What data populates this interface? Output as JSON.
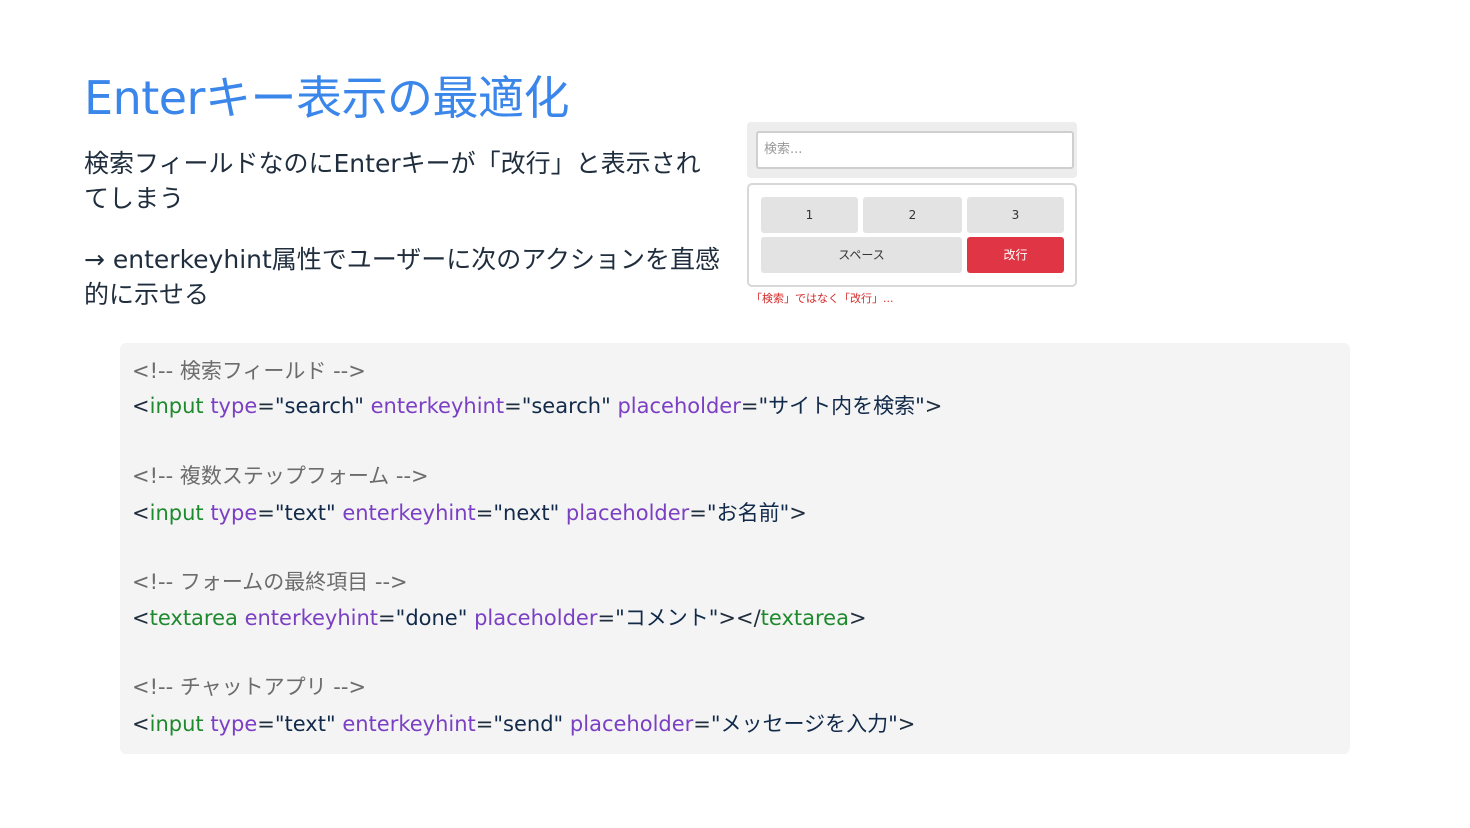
{
  "title": "Enterキー表示の最適化",
  "description": {
    "line1": "検索フィールドなのにEnterキーが「改行」と表示されてしまう",
    "line2": "→ enterkeyhint属性でユーザーに次のアクションを直感的に示せる"
  },
  "demo": {
    "search_placeholder": "検索...",
    "keys": [
      "1",
      "2",
      "3"
    ],
    "space_label": "スペース",
    "enter_label": "改行",
    "caption": "「検索」ではなく「改行」..."
  },
  "code": {
    "comment1": "<!-- 検索フィールド -->",
    "comment2": "<!-- 複数ステップフォーム -->",
    "comment3": "<!-- フォームの最終項目 -->",
    "comment4": "<!-- チャットアプリ -->",
    "tag_input": "input",
    "tag_textarea": "textarea",
    "attr_type": "type",
    "attr_enterkeyhint": "enterkeyhint",
    "attr_placeholder": "placeholder",
    "val_search": "\"search\"",
    "val_text": "\"text\"",
    "val_next": "\"next\"",
    "val_done": "\"done\"",
    "val_send": "\"send\"",
    "ph1": "\"サイト内を検索\"",
    "ph2": "\"お名前\"",
    "ph3": "\"コメント\"",
    "ph4": "\"メッセージを入力\""
  }
}
